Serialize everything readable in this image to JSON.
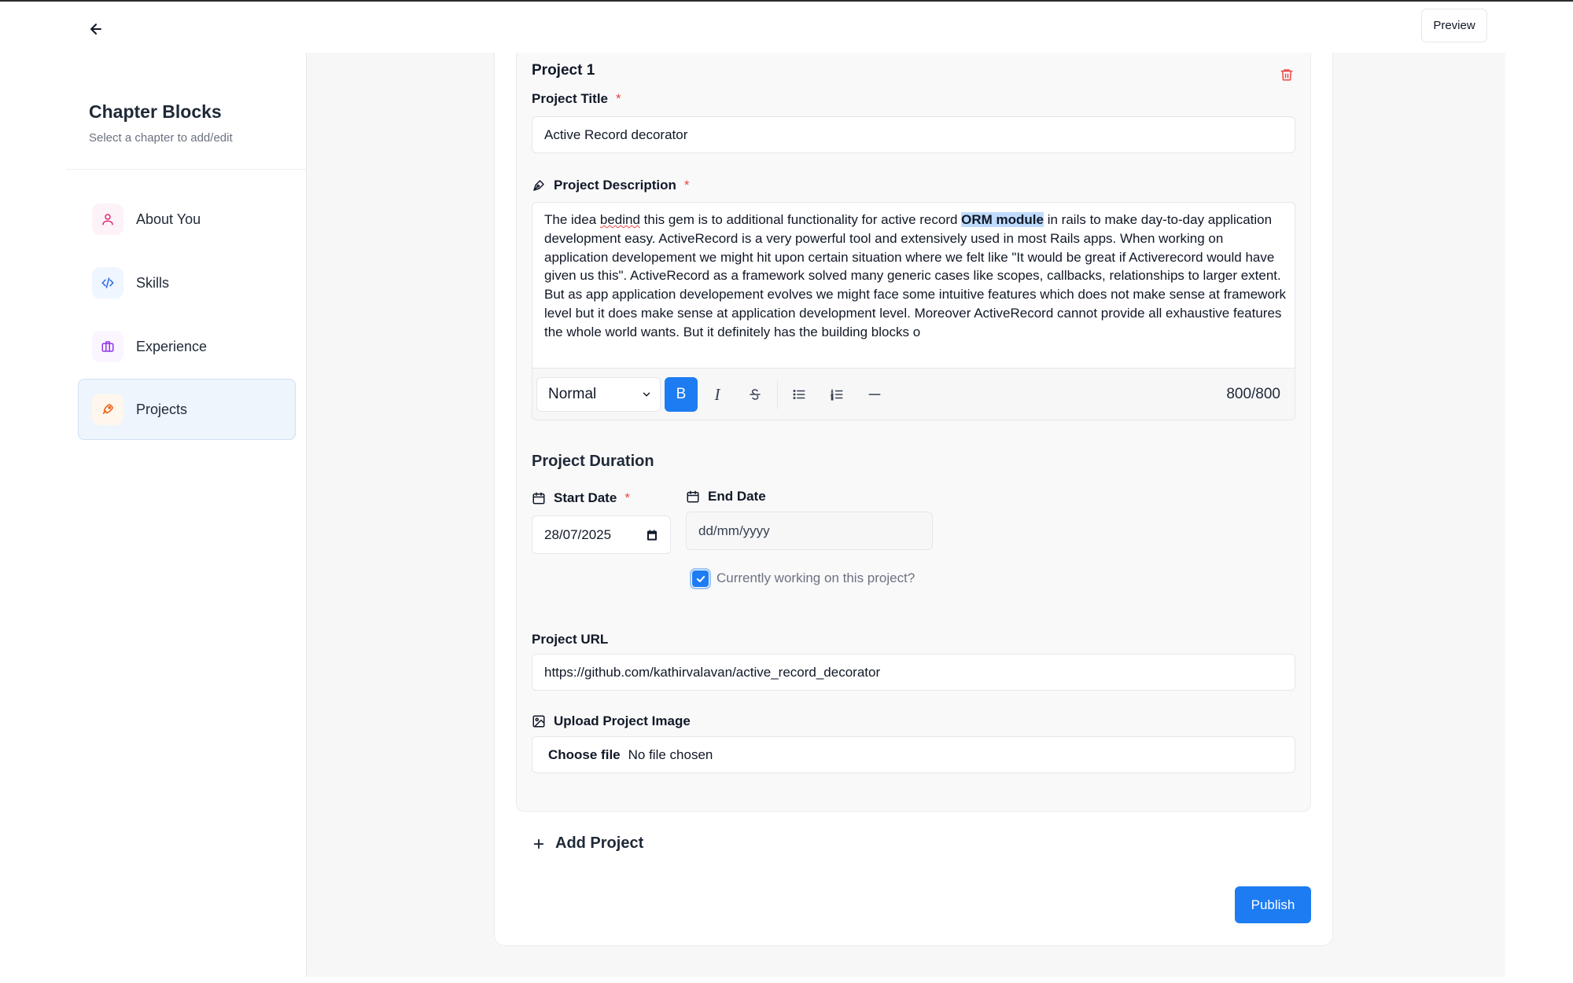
{
  "header": {
    "back_icon": "arrow-left-icon",
    "preview_label": "Preview"
  },
  "sidebar": {
    "title": "Chapter Blocks",
    "subtitle": "Select a chapter to add/edit",
    "items": [
      {
        "label": "About You",
        "icon": "user-icon",
        "color": "#db2777",
        "bg": "#fdf2f8",
        "active": false
      },
      {
        "label": "Skills",
        "icon": "code-icon",
        "color": "#2563eb",
        "bg": "#eff6ff",
        "active": false
      },
      {
        "label": "Experience",
        "icon": "briefcase-icon",
        "color": "#9333ea",
        "bg": "#faf5ff",
        "active": false
      },
      {
        "label": "Projects",
        "icon": "rocket-icon",
        "color": "#ea580c",
        "bg": "#fff7ed",
        "active": true
      }
    ]
  },
  "project": {
    "heading": "Project 1",
    "delete_icon": "trash-icon",
    "title_label": "Project Title",
    "title_value": "Active Record decorator",
    "desc_label": "Project Description",
    "desc_segments": {
      "s1": "The idea ",
      "misspelled": "bedind",
      "s2": " this gem is to additional functionality for active record ",
      "highlight": "ORM module",
      "s3": " in rails to make day-to-day application development easy. ActiveRecord is a very powerful tool and extensively used in most Rails apps. When working on application developement we might hit upon certain situation where we felt like \"It would be great if Activerecord would have given us this\". ActiveRecord as a framework solved many generic cases like scopes, callbacks, relationships to larger extent. But as app application developement evolves we might face some intuitive features which does not make sense at framework level but it does make sense at application development level. Moreover ActiveRecord cannot provide all exhaustive features the whole world wants. But it definitely has the building blocks o"
    },
    "editor": {
      "format_value": "Normal",
      "bold": "B",
      "italic": "I",
      "char_count": "800/800"
    },
    "duration_title": "Project Duration",
    "start_label": "Start Date",
    "start_value": "28/07/2025",
    "end_label": "End Date",
    "end_placeholder": "dd/mm/yyyy",
    "currently_working_label": "Currently working on this project?",
    "currently_working": true,
    "url_label": "Project URL",
    "url_value": "https://github.com/kathirvalavan/active_record_decorator",
    "upload_label": "Upload Project Image",
    "choose_file": "Choose file",
    "file_status": "No file chosen"
  },
  "actions": {
    "add_project": "Add Project",
    "publish": "Publish"
  },
  "colors": {
    "accent": "#1d7cf2",
    "danger": "#ef4444",
    "active_nav_bg": "#eef5fd"
  }
}
